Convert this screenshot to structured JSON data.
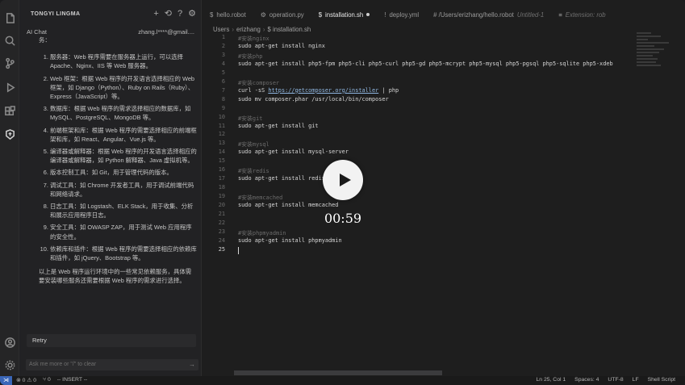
{
  "sidebar": {
    "title": "TONGYI LINGMA",
    "chat_label": "AI Chat",
    "user": "zhang.l****@gmail....",
    "intro": "务：",
    "items": [
      "服务器：Web 程序需要在服务器上运行，可以选择 Apache、Nginx、IIS 等 Web 服务器。",
      "Web 框架：根据 Web 程序的开发语言选择相应的 Web 框架，如 Django（Python）、Ruby on Rails（Ruby）、Express（JavaScript）等。",
      "数据库：根据 Web 程序的需求选择相应的数据库，如 MySQL、PostgreSQL、MongoDB 等。",
      "前端框架和库：根据 Web 程序的需要选择相应的前端框架和库，如 React、Angular、Vue.js 等。",
      "编译器或解释器：根据 Web 程序的开发语言选择相应的编译器或解释器，如 Python 解释器、Java 虚拟机等。",
      "版本控制工具：如 Git，用于管理代码的版本。",
      "调试工具：如 Chrome 开发者工具，用于调试前端代码和网络请求。",
      "日志工具：如 Logstash、ELK Stack，用于收集、分析和展示应用程序日志。",
      "安全工具：如 OWASP ZAP，用于测试 Web 应用程序的安全性。",
      "依赖库和插件：根据 Web 程序的需要选择相应的依赖库和插件，如 jQuery、Bootstrap 等。"
    ],
    "outro": "以上是 Web 程序运行环境中的一些常见依赖服务，具体需要安装哪些服务还需要根据 Web 程序的需求进行选择。",
    "retry_label": "Retry",
    "ask_placeholder": "Ask me more or \"/\" to clear"
  },
  "tabs": [
    {
      "label": "hello.robot",
      "icon": "$",
      "active": false
    },
    {
      "label": "operation.py",
      "icon": "⚙",
      "active": false
    },
    {
      "label": "installation.sh",
      "icon": "$",
      "active": true,
      "dirty": true
    },
    {
      "label": "deploy.yml",
      "icon": "!",
      "active": false
    },
    {
      "label": "# /Users/erizhang/hello.robot",
      "icon": "",
      "active": false,
      "extra": "Untitled-1"
    },
    {
      "label": "Extension: rob",
      "icon": "≡",
      "active": false
    }
  ],
  "breadcrumb": [
    "Users",
    "erizhang",
    "$ installation.sh"
  ],
  "code_lines": [
    {
      "n": "1",
      "t": "#安装nginx",
      "c": true
    },
    {
      "n": "2",
      "t": "sudo apt-get install nginx"
    },
    {
      "n": "3",
      "t": "#安装php",
      "c": true
    },
    {
      "n": "4",
      "t": "sudo apt-get install php5-fpm php5-cli php5-curl php5-gd php5-mcrypt php5-mysql php5-pgsql php5-sqlite php5-xdeb"
    },
    {
      "n": "5",
      "t": ""
    },
    {
      "n": "6",
      "t": "#安装composer",
      "c": true
    },
    {
      "n": "7",
      "t": "curl -sS https://getcomposer.org/installer | php"
    },
    {
      "n": "8",
      "t": "sudo mv composer.phar /usr/local/bin/composer"
    },
    {
      "n": "9",
      "t": ""
    },
    {
      "n": "10",
      "t": "#安装git",
      "c": true
    },
    {
      "n": "11",
      "t": "sudo apt-get install git"
    },
    {
      "n": "12",
      "t": ""
    },
    {
      "n": "13",
      "t": "#安装mysql",
      "c": true
    },
    {
      "n": "14",
      "t": "sudo apt-get install mysql-server"
    },
    {
      "n": "15",
      "t": ""
    },
    {
      "n": "16",
      "t": "#安装redis",
      "c": true
    },
    {
      "n": "17",
      "t": "sudo apt-get install redis-server"
    },
    {
      "n": "18",
      "t": ""
    },
    {
      "n": "19",
      "t": "#安装memcached",
      "c": true
    },
    {
      "n": "20",
      "t": "sudo apt-get install memcached"
    },
    {
      "n": "21",
      "t": ""
    },
    {
      "n": "22",
      "t": ""
    },
    {
      "n": "23",
      "t": "#安装phpmyadmin",
      "c": true
    },
    {
      "n": "24",
      "t": "sudo apt-get install phpmyadmin"
    },
    {
      "n": "25",
      "t": "",
      "current": true
    }
  ],
  "video": {
    "time": "00:59"
  },
  "status": {
    "remote": "⋊",
    "problems": "⊗ 0 ⚠ 0",
    "ports": "⑂ 0",
    "mode": "-- INSERT --",
    "position": "Ln 25, Col 1",
    "spaces": "Spaces: 4",
    "encoding": "UTF-8",
    "eol": "LF",
    "language": "Shell Script"
  }
}
